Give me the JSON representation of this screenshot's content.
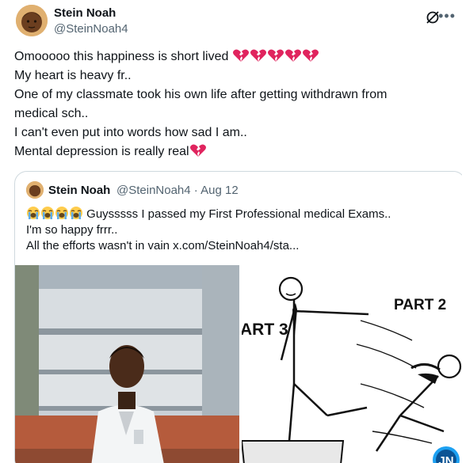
{
  "tweet": {
    "author_name": "Stein Noah",
    "author_handle": "@SteinNoah4",
    "lines": [
      "Omooooo this happiness is short lived",
      "My heart is heavy fr..",
      "One of my classmate took his own life after getting withdrawn from",
      "medical sch..",
      "I can't even put into words how sad I am..",
      "Mental depression is really real"
    ],
    "broken_heart_icon": "broken-heart-emoji",
    "colors": {
      "text": "#0f1419",
      "secondary": "#536471",
      "border": "#cfd9de",
      "heart": "#e0245e"
    }
  },
  "quoted_tweet": {
    "author_name": "Stein Noah",
    "author_handle": "@SteinNoah4",
    "date": "· Aug 12",
    "lines": [
      "Guysssss I passed my First Professional medical Exams..",
      "I'm so happy frrr..",
      "All the efforts wasn't in vain  x.com/SteinNoah4/sta..."
    ],
    "emoji_icon": "loudly-crying-face-emoji",
    "cartoon_labels": {
      "part3": "ART 3",
      "part2": "PART 2"
    },
    "watermark": "JN"
  }
}
